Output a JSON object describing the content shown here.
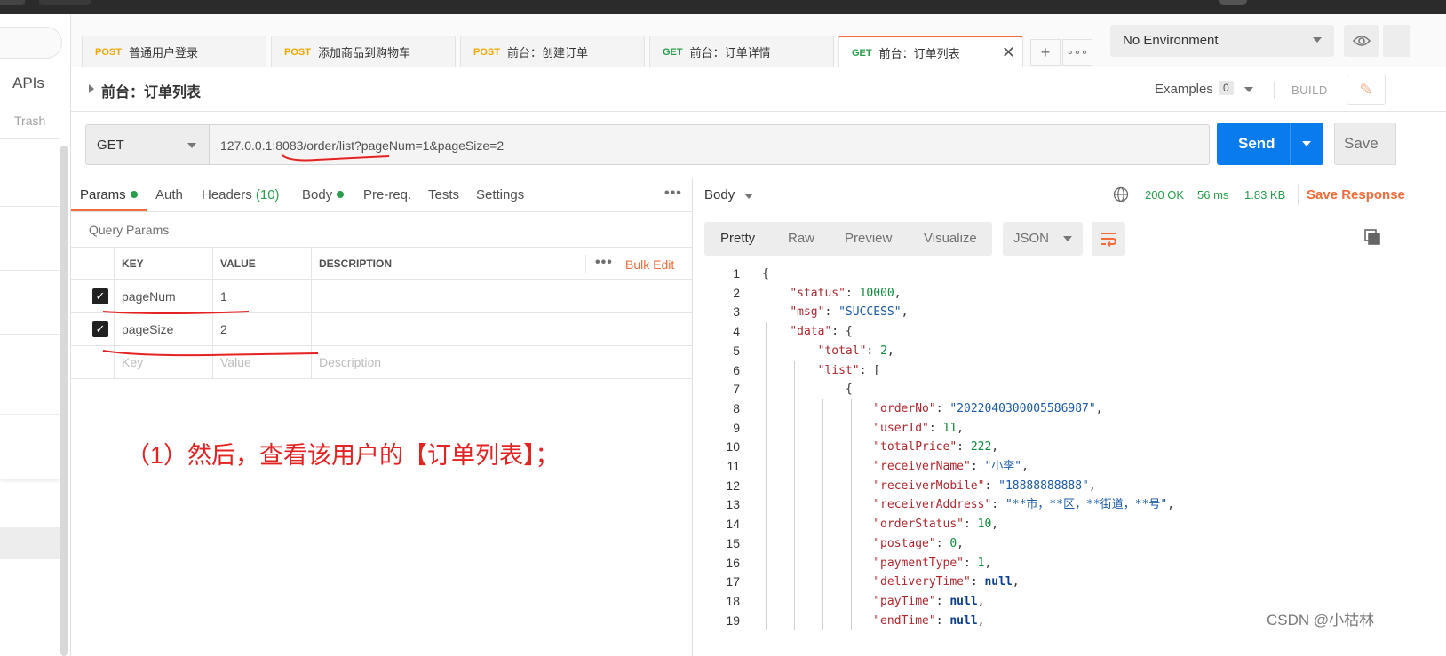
{
  "tabs": [
    {
      "method": "POST",
      "label": "普通用户登录"
    },
    {
      "method": "POST",
      "label": "添加商品到购物车"
    },
    {
      "method": "POST",
      "label": "前台：创建订单"
    },
    {
      "method": "GET",
      "label": "前台：订单详情"
    },
    {
      "method": "GET",
      "label": "前台：订单列表"
    }
  ],
  "sidebar": {
    "apis": "APIs",
    "trash": "Trash"
  },
  "environment": {
    "selected": "No Environment"
  },
  "request": {
    "title": "前台：订单列表",
    "examples_label": "Examples",
    "examples_count": "0",
    "build_label": "BUILD",
    "method": "GET",
    "url": "127.0.0.1:8083/order/list?pageNum=1&pageSize=2",
    "send_label": "Send",
    "save_label": "Save"
  },
  "request_tabs": {
    "params": "Params",
    "auth": "Auth",
    "headers": "Headers",
    "headers_count": "(10)",
    "body": "Body",
    "prereq": "Pre-req.",
    "tests": "Tests",
    "settings": "Settings"
  },
  "query_params": {
    "label": "Query Params",
    "headers": [
      "KEY",
      "VALUE",
      "DESCRIPTION"
    ],
    "bulk_edit": "Bulk Edit",
    "rows": [
      {
        "key": "pageNum",
        "value": "1"
      },
      {
        "key": "pageSize",
        "value": "2"
      }
    ],
    "placeholder": {
      "key": "Key",
      "value": "Value",
      "description": "Description"
    }
  },
  "annotation": "（1）然后，查看该用户的【订单列表】；",
  "response": {
    "body_label": "Body",
    "status": "200 OK",
    "time": "56 ms",
    "size": "1.83 KB",
    "save_response": "Save Response",
    "formats": [
      "Pretty",
      "Raw",
      "Preview",
      "Visualize"
    ],
    "language": "JSON",
    "code_lines": [
      "{",
      "    \"status\": 10000,",
      "    \"msg\": \"SUCCESS\",",
      "    \"data\": {",
      "        \"total\": 2,",
      "        \"list\": [",
      "            {",
      "                \"orderNo\": \"2022040300005586987\",",
      "                \"userId\": 11,",
      "                \"totalPrice\": 222,",
      "                \"receiverName\": \"小李\",",
      "                \"receiverMobile\": \"18888888888\",",
      "                \"receiverAddress\": \"**市，**区，**街道，**号\",",
      "                \"orderStatus\": 10,",
      "                \"postage\": 0,",
      "                \"paymentType\": 1,",
      "                \"deliveryTime\": null,",
      "                \"payTime\": null,",
      "                \"endTime\": null,"
    ]
  },
  "colors": {
    "accent": "#f26b3a",
    "send": "#097bed",
    "ok": "#2a9d4a",
    "annotation": "#e52222"
  },
  "watermark": "CSDN @小枯林"
}
